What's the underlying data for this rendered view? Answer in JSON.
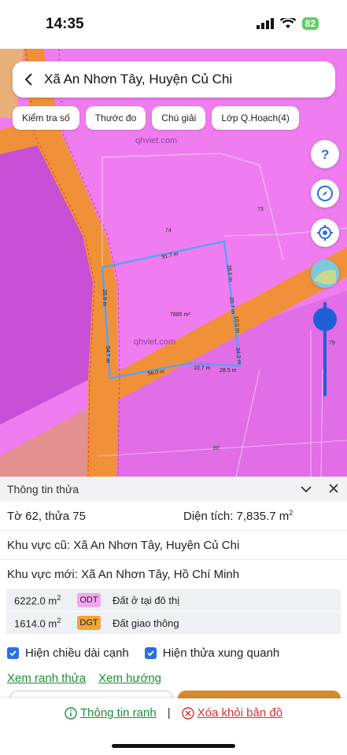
{
  "status_bar": {
    "time": "14:35",
    "battery": "82"
  },
  "search": {
    "text": "Xã An Nhơn Tây, Huyện Củ Chi"
  },
  "chips": [
    {
      "label": "Kiểm tra số"
    },
    {
      "label": "Thước đo"
    },
    {
      "label": "Chú giải"
    },
    {
      "label": "Lớp Q.Hoạch(4)"
    }
  ],
  "map": {
    "watermark": "qhviet.com",
    "parcel_area": "7885 m²",
    "edges": [
      "91.7 m",
      "28.6 m",
      "20.7 m",
      "10.0 m",
      "34.3 m",
      "28.5 m",
      "10.7 m",
      "56.0 m",
      "54.7 m",
      "26.9 m"
    ],
    "neighbors": [
      "74",
      "73",
      "79",
      "80"
    ],
    "colors": {
      "land": "#f07df0",
      "road": "#f0913a",
      "outline": "#5aa0f0"
    }
  },
  "panel": {
    "title": "Thông tin thửa",
    "sheet_parcel": "Tờ 62, thửa 75",
    "area_label": "Diện tích: 7,835.7 m",
    "area_sup": "2",
    "old_area": "Khu vực cũ: Xã An Nhơn Tây, Huyện Củ Chi",
    "new_area": "Khu vực mới: Xã An Nhơn Tây, Hồ Chí Minh",
    "zones": [
      {
        "area": "6222.0 m",
        "sup": "2",
        "code": "ODT",
        "name": "Đất ở tại đô thị",
        "color": "#f5a6f0"
      },
      {
        "area": "1614.0 m",
        "sup": "2",
        "code": "DGT",
        "name": "Đất giao thông",
        "color": "#f0a53a"
      }
    ],
    "check_edges": "Hiện chiều dài cạnh",
    "check_neighbors": "Hiện thửa xung quanh",
    "link_boundary": "Xem ranh thửa",
    "link_direction": "Xem hướng"
  },
  "footer": {
    "info_link": "Thông tin ranh",
    "separator": "|",
    "remove_link": "Xóa khỏi bản đồ"
  }
}
